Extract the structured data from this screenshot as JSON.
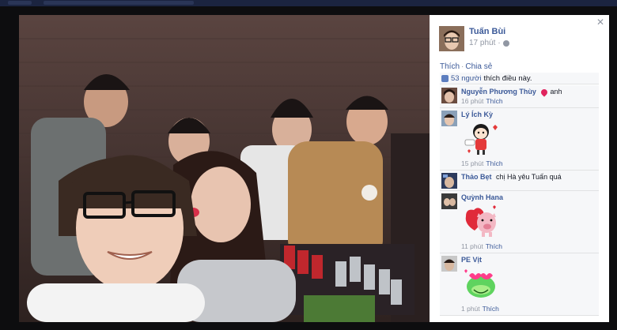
{
  "post": {
    "author_name": "Tuấn Bùi",
    "time": "17 phút",
    "action_like": "Thích",
    "action_share": "Chia sẻ",
    "action_sep": "·",
    "likes_count": "53 người",
    "likes_text": "thích điều này."
  },
  "comments": [
    {
      "name": "Nguyễn Phương Thùy",
      "text": "anh",
      "time": "16 phút",
      "like": "Thích",
      "has_heart": true
    },
    {
      "name": "Lý Ích Kỳ",
      "text": "",
      "time": "15 phút",
      "like": "Thích",
      "sticker": "hugging-girl-sticker"
    },
    {
      "name": "Thảo Bẹt",
      "text": "chị Hà yêu Tuấn quá",
      "time": "",
      "like": "",
      "sticker": ""
    },
    {
      "name": "Quỳnh Hana",
      "text": "",
      "time": "11 phút",
      "like": "Thích",
      "sticker": "pig-heart-sticker"
    },
    {
      "name": "PE Vịt",
      "text": "",
      "time": "1 phút",
      "like": "Thích",
      "sticker": "frog-heart-eyes-sticker"
    }
  ],
  "icons": {
    "close": "close-icon",
    "globe": "globe-icon",
    "like": "thumbs-up-icon"
  },
  "colors": {
    "link": "#3b5998",
    "meta": "#9197a3",
    "comment_bg": "#f6f7f9",
    "like_icon": "#5d7ebf"
  }
}
